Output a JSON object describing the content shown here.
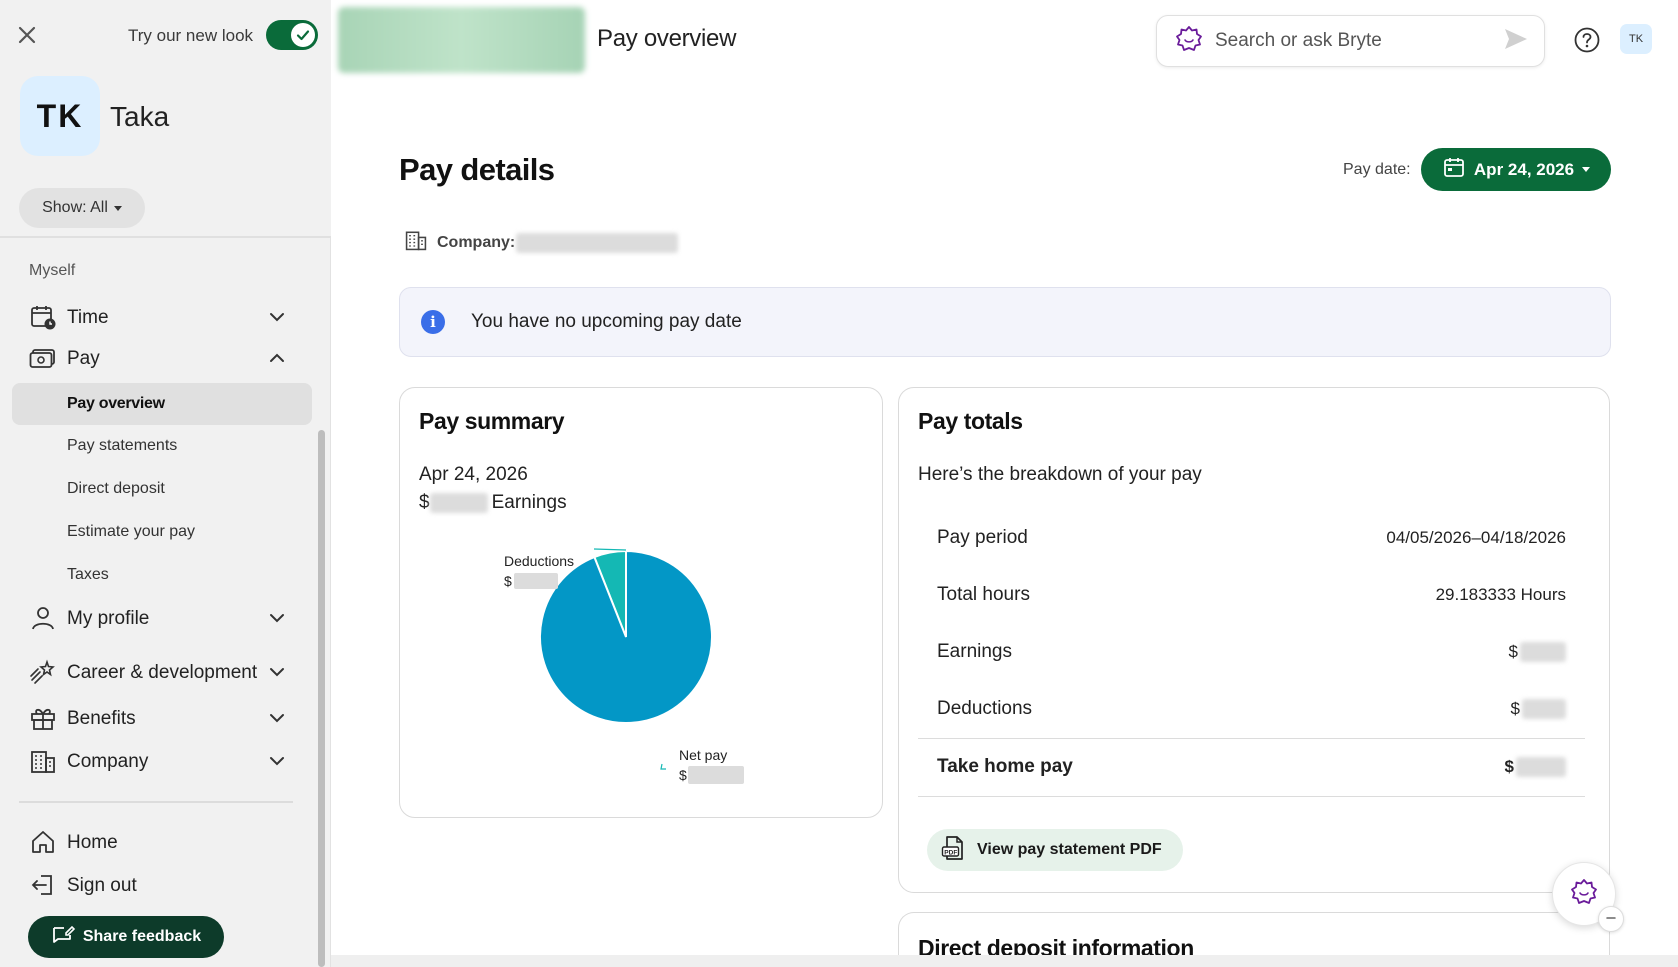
{
  "sidebar": {
    "try_new_look": "Try our new look",
    "toggle_on": true,
    "avatar_initials": "TK",
    "user_name": "Taka",
    "show_filter": "Show: All",
    "section_label": "Myself",
    "items": [
      {
        "label": "Time",
        "icon": "calendar-clock-icon",
        "expanded": false
      },
      {
        "label": "Pay",
        "icon": "money-icon",
        "expanded": true
      },
      {
        "label": "My profile",
        "icon": "person-icon",
        "expanded": false
      },
      {
        "label": "Career & development",
        "icon": "shooting-star-icon",
        "expanded": false
      },
      {
        "label": "Benefits",
        "icon": "gift-icon",
        "expanded": false
      },
      {
        "label": "Company",
        "icon": "building-icon",
        "expanded": false
      }
    ],
    "pay_subitems": [
      "Pay overview",
      "Pay statements",
      "Direct deposit",
      "Estimate your pay",
      "Taxes"
    ],
    "active_subitem": "Pay overview",
    "footer": {
      "home": "Home",
      "sign_out": "Sign out",
      "share_feedback": "Share feedback"
    }
  },
  "header": {
    "title": "Pay overview",
    "search_placeholder": "Search or ask Bryte",
    "avatar_initials": "TK"
  },
  "main": {
    "title": "Pay details",
    "pay_date_label": "Pay date:",
    "pay_date_value": "Apr 24, 2026",
    "company_label": "Company:",
    "info_banner": "You have no upcoming pay date",
    "pay_summary": {
      "title": "Pay summary",
      "date": "Apr 24, 2026",
      "currency": "$",
      "earnings_label": "Earnings",
      "deductions_label": "Deductions",
      "net_pay_label": "Net pay"
    },
    "pay_totals": {
      "title": "Pay totals",
      "subtitle": "Here’s the breakdown of your pay",
      "rows": [
        {
          "label": "Pay period",
          "value": "04/05/2026–04/18/2026"
        },
        {
          "label": "Total hours",
          "value": "29.183333 Hours"
        },
        {
          "label": "Earnings",
          "value": "$"
        },
        {
          "label": "Deductions",
          "value": "$"
        },
        {
          "label": "Take home pay",
          "value": "$"
        }
      ],
      "pdf_button": "View pay statement PDF"
    },
    "direct_deposit_title": "Direct deposit information"
  },
  "chart_data": {
    "type": "pie",
    "slices": [
      {
        "name": "Deductions",
        "value": 6,
        "color": "#14b8b4"
      },
      {
        "name": "Net pay",
        "value": 94,
        "color": "#0397c6"
      }
    ]
  },
  "colors": {
    "brand_green": "#0a6b3a",
    "pie_net": "#0397c6",
    "pie_deductions": "#14b8b4",
    "info_blue": "#3a6ee8"
  }
}
